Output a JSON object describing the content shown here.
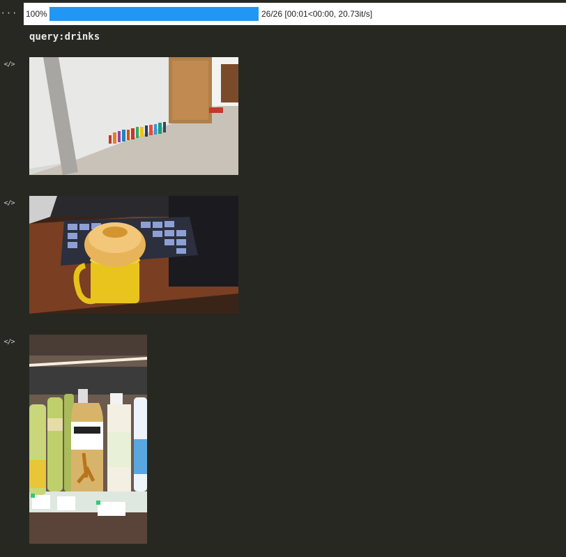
{
  "output": {
    "more_icon": "ellipsis-icon",
    "code_icon": "code-icon",
    "progress": {
      "percent_label": "100%",
      "fraction": 1.0,
      "status": "26/26 [00:01<00:00, 20.73it/s]",
      "fill_color": "#2196f3"
    },
    "query": "query:drinks",
    "images": [
      {
        "name": "drinks-floor-photo",
        "description_icon": "photo-icon"
      },
      {
        "name": "bun-on-mug-photo",
        "description_icon": "photo-icon"
      },
      {
        "name": "bottles-on-shelf-photo",
        "description_icon": "photo-icon"
      }
    ]
  }
}
